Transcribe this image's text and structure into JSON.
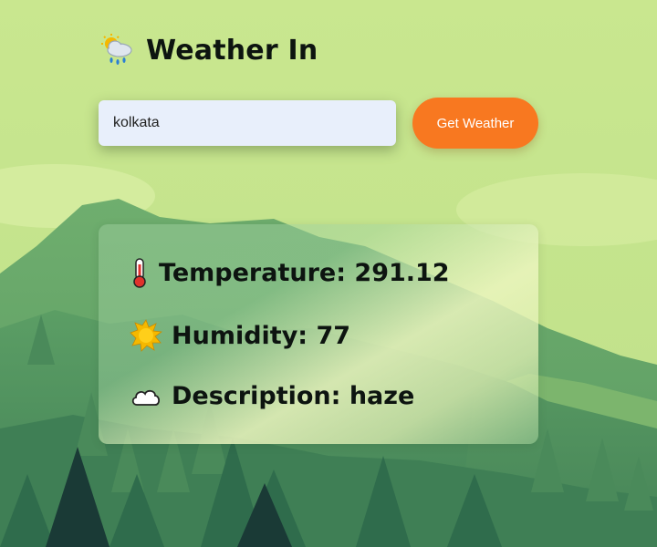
{
  "header": {
    "title": "Weather In",
    "icon": "cloud-rain-sun-icon"
  },
  "search": {
    "value": "kolkata",
    "placeholder": ""
  },
  "button": {
    "label": "Get Weather"
  },
  "results": {
    "temperature": {
      "label": "Temperature: 291.12",
      "icon": "thermometer-icon"
    },
    "humidity": {
      "label": "Humidity: 77",
      "icon": "sun-icon"
    },
    "description": {
      "label": "Description: haze",
      "icon": "cloud-icon"
    }
  },
  "colors": {
    "background": "#c8e68d",
    "button": "#f87820",
    "input_bg": "#e8effb",
    "text": "#0d1410"
  }
}
